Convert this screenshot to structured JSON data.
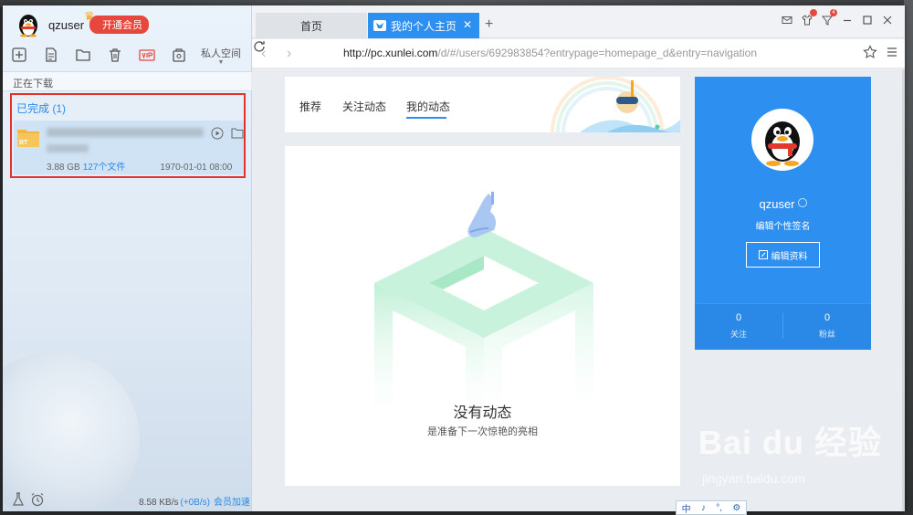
{
  "app": {
    "username": "qzuser",
    "vip_label": "开通会员",
    "private_space": "私人空间"
  },
  "left": {
    "downloading_tab": "正在下载",
    "completed_title": "已完成 (1)",
    "task": {
      "type_badge": "BT",
      "size": "3.88 GB",
      "files": "127个文件",
      "date": "1970-01-01 08:00"
    },
    "status": {
      "speed": "8.58 KB/s",
      "bonus": "(+0B/s)",
      "accelerate": "会员加速"
    }
  },
  "browser": {
    "tabs": [
      {
        "label": "首页",
        "active": false
      },
      {
        "label": "我的个人主页",
        "active": true
      }
    ],
    "notif_count": "4",
    "url_host": "http://pc.xunlei.com",
    "url_path": "/d/#/users/692983854?entrypage=homepage_d&entry=navigation"
  },
  "feed": {
    "tabs": [
      "推荐",
      "关注动态",
      "我的动态"
    ],
    "active_tab": "我的动态",
    "empty_title": "没有动态",
    "empty_subtitle": "是准备下一次惊艳的亮相"
  },
  "profile": {
    "name": "qzuser",
    "signature": "编辑个性签名",
    "edit_button": "编辑资料",
    "following_count": "0",
    "following_label": "关注",
    "followers_count": "0",
    "followers_label": "粉丝"
  },
  "ime": [
    "中",
    "♪",
    "°,",
    "⚙"
  ],
  "watermark": {
    "text": "Bai du 经验",
    "url": "jingyan.baidu.com"
  },
  "colors": {
    "accent": "#2d8ff0",
    "vip": "#e6483d",
    "highlight_border": "#e5322d"
  }
}
